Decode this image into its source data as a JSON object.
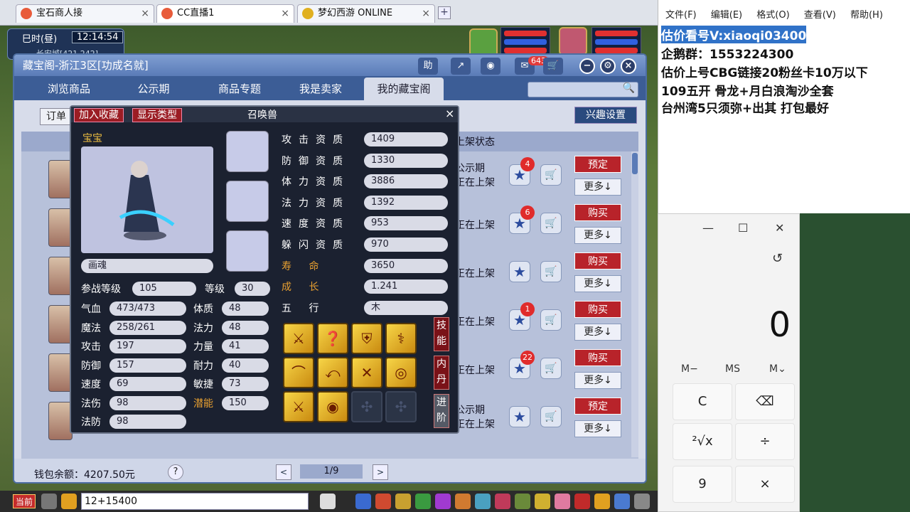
{
  "browser": {
    "tabs": [
      {
        "label": "宝石商人接",
        "close": "×"
      },
      {
        "label": "CC直播1",
        "close": "×"
      },
      {
        "label": "梦幻西游 ONLINE",
        "close": "×"
      }
    ],
    "new_tab": "+"
  },
  "game": {
    "time_label": "巳时(昼)",
    "clock": "12:14:54",
    "location": "长安城[421,242]"
  },
  "cbg": {
    "title": "藏宝阁-浙江3区[功成名就]",
    "header_buttons": {
      "help": "助",
      "share": "↗",
      "settings": "◉",
      "msg_count": "643",
      "cart": "🛒"
    },
    "window_controls": {
      "minimize": "−",
      "gear": "⚙",
      "close": "×"
    },
    "nav_tabs": [
      "浏览商品",
      "公示期",
      "商品专题",
      "我是卖家",
      "我的藏宝阁"
    ],
    "active_tab": "我的藏宝阁",
    "search_icon": "🔍",
    "order_btn": "订单",
    "interest_btn": "兴趣设置",
    "list_header_status": "上架状态",
    "rows": [
      {
        "status_line1": "公示期",
        "status_line2": "正在上架",
        "badge": "4",
        "action": "预定",
        "more": "更多↓"
      },
      {
        "status_line1": "",
        "status_line2": "正在上架",
        "badge": "6",
        "action": "购买",
        "more": "更多↓"
      },
      {
        "status_line1": "",
        "status_line2": "正在上架",
        "badge": "",
        "action": "购买",
        "more": "更多↓"
      },
      {
        "status_line1": "",
        "status_line2": "正在上架",
        "badge": "1",
        "action": "购买",
        "more": "更多↓"
      },
      {
        "status_line1": "",
        "status_line2": "正在上架",
        "badge": "22",
        "action": "购买",
        "more": "更多↓"
      },
      {
        "status_line1": "公示期",
        "status_line2": "正在上架",
        "badge": "",
        "action": "预定",
        "more": "更多↓"
      }
    ],
    "star_glyph": "★",
    "cart_glyph": "🛒",
    "wallet": "钱包余额：4207.50元",
    "help": "?",
    "prev": "<",
    "next": ">",
    "page": "1/9"
  },
  "pet": {
    "add_fav": "加入收藏",
    "show_type": "显示类型",
    "title": "召唤兽",
    "close": "×",
    "baby_label": "宝宝",
    "name": "画魂",
    "level_labels": {
      "battle": "参战等级",
      "level": "等级"
    },
    "battle_level": "105",
    "level": "30",
    "stats": [
      {
        "label": "气血",
        "value": "473/473"
      },
      {
        "label": "魔法",
        "value": "258/261"
      },
      {
        "label": "攻击",
        "value": "197"
      },
      {
        "label": "防御",
        "value": "157"
      },
      {
        "label": "速度",
        "value": "69"
      },
      {
        "label": "法伤",
        "value": "98"
      },
      {
        "label": "法防",
        "value": "98"
      }
    ],
    "attrs": [
      {
        "label": "体质",
        "value": "48"
      },
      {
        "label": "法力",
        "value": "48"
      },
      {
        "label": "力量",
        "value": "41"
      },
      {
        "label": "耐力",
        "value": "40"
      },
      {
        "label": "敏捷",
        "value": "73"
      },
      {
        "label": "潜能",
        "value": "150"
      }
    ],
    "aptitudes": [
      {
        "label": "攻击资质",
        "value": "1409"
      },
      {
        "label": "防御资质",
        "value": "1330"
      },
      {
        "label": "体力资质",
        "value": "3886"
      },
      {
        "label": "法力资质",
        "value": "1392"
      },
      {
        "label": "速度资质",
        "value": "953"
      },
      {
        "label": "躲闪资质",
        "value": "970"
      },
      {
        "label": "寿  命",
        "value": "3650"
      },
      {
        "label": "成  长",
        "value": "1.241"
      },
      {
        "label": "五  行",
        "value": "木"
      }
    ],
    "side_tabs": [
      "技能",
      "内丹",
      "进阶"
    ]
  },
  "gamebar": {
    "current": "当前",
    "chat_input": "12+15400"
  },
  "notepad": {
    "menu": [
      "文件(F)",
      "编辑(E)",
      "格式(O)",
      "查看(V)",
      "帮助(H)"
    ],
    "lines": [
      "估价看号V:xiaoqi03400",
      "企鹅群：1553224300",
      "估价上号CBG链接20粉丝卡10万以下",
      "109五开 骨龙+月白浪淘沙全套",
      "台州湾5只须弥+出其 打包最好"
    ]
  },
  "calculator": {
    "controls": {
      "min": "—",
      "max": "☐",
      "close": "✕"
    },
    "history": "↺",
    "display": "0",
    "memory": [
      "M−",
      "MS",
      "M⌄"
    ],
    "keys": [
      "C",
      "⌫",
      "²√x",
      "÷",
      "9",
      "×"
    ]
  }
}
